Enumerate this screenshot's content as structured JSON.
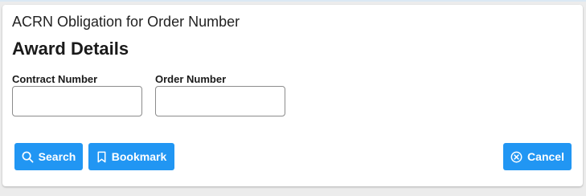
{
  "header": {
    "subtitle": "ACRN Obligation for Order Number",
    "title": "Award Details"
  },
  "form": {
    "contract_number": {
      "label": "Contract Number",
      "value": "",
      "placeholder": ""
    },
    "order_number": {
      "label": "Order Number",
      "value": "",
      "placeholder": ""
    }
  },
  "actions": {
    "search_label": "Search",
    "bookmark_label": "Bookmark",
    "cancel_label": "Cancel"
  },
  "theme": {
    "button_color": "#2196f3",
    "icons": [
      "search-icon",
      "bookmark-icon",
      "cancel-circle-icon"
    ]
  }
}
